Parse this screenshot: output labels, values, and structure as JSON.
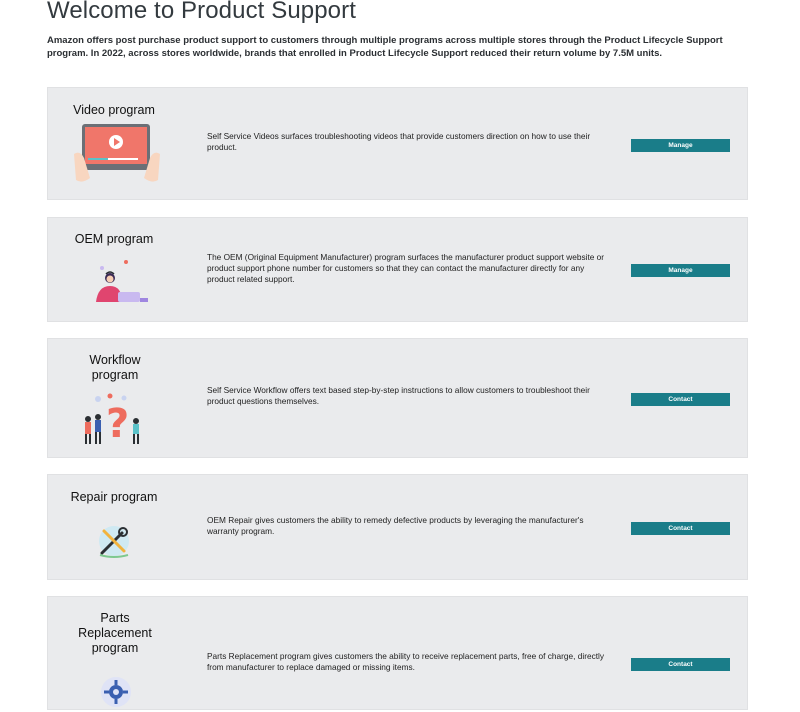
{
  "page": {
    "title": "Welcome to Product Support",
    "intro": "Amazon offers post purchase product support to customers through multiple programs across multiple stores through the Product Lifecycle Support program. In 2022, across stores worldwide, brands that enrolled in Product Lifecycle Support reduced their return volume by 7.5M units."
  },
  "colors": {
    "button": "#1a7d89",
    "card_bg": "#eaebed",
    "illustration_accent": "#ee6c5e"
  },
  "programs": [
    {
      "title": "Video program",
      "description": "Self Service Videos surfaces troubleshooting videos that provide customers direction on how to use their product.",
      "button": "Manage",
      "icon": "tablet-video-icon"
    },
    {
      "title": "OEM program",
      "description": "The OEM (Original Equipment Manufacturer) program surfaces the manufacturer product support website or product support phone number for customers so that they can contact the manufacturer directly for any product related support.",
      "button": "Manage",
      "icon": "support-agent-icon"
    },
    {
      "title": "Workflow program",
      "description": "Self Service Workflow offers text based step-by-step instructions to allow customers to troubleshoot their product questions themselves.",
      "button": "Contact",
      "icon": "question-mark-people-icon"
    },
    {
      "title": "Repair program",
      "description": "OEM Repair gives customers the ability to remedy defective products by leveraging the manufacturer's warranty program.",
      "button": "Contact",
      "icon": "wrench-screwdriver-icon"
    },
    {
      "title": "Parts Replacement program",
      "description": "Parts Replacement program gives customers the ability to receive replacement parts, free of charge, directly from manufacturer to replace damaged or missing items.",
      "button": "Contact",
      "icon": "gear-icon"
    }
  ]
}
